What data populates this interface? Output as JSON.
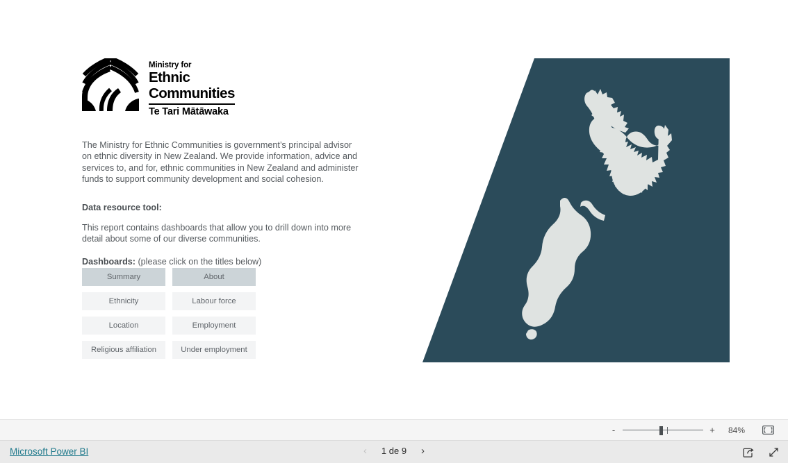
{
  "logo": {
    "mark_icon": "woven-fern-mark-icon",
    "line1": "Ministry for",
    "line2": "Ethnic",
    "line3": "Communities",
    "line4": "Te Tari Mātāwaka"
  },
  "content": {
    "intro_paragraph": "The Ministry for Ethnic Communities is government’s principal advisor on ethnic diversity in New Zealand. We provide information, advice and services to, and for, ethnic communities in New Zealand and administer funds to support community development and social cohesion.",
    "section_heading": "Data resource tool:",
    "report_description": "This report contains dashboards that allow you to drill down into more detail about some of our diverse communities.",
    "dashboards_label": "Dashboards:",
    "dashboards_hint": "(please click on the titles below)"
  },
  "dashboards": {
    "rows": [
      [
        {
          "label": "Summary",
          "selected": true
        },
        {
          "label": "About",
          "selected": true
        }
      ],
      [
        {
          "label": "Ethnicity",
          "selected": false
        },
        {
          "label": "Labour force",
          "selected": false
        }
      ],
      [
        {
          "label": "Location",
          "selected": false
        },
        {
          "label": "Employment",
          "selected": false
        }
      ],
      [
        {
          "label": "Religious affiliation",
          "selected": false
        },
        {
          "label": "Under employment",
          "selected": false
        }
      ]
    ]
  },
  "map": {
    "name": "new-zealand-map",
    "background_color": "#2b4b5a",
    "land_color": "#dfe3e1"
  },
  "zoom_toolbar": {
    "minus_label": "-",
    "plus_label": "+",
    "percent": "84%",
    "fit_icon": "fit-to-page-icon"
  },
  "footer": {
    "brand": "Microsoft Power BI",
    "brand_color": "#217a8c",
    "prev_icon": "chevron-left-icon",
    "next_icon": "chevron-right-icon",
    "page_indicator": "1 de 9",
    "share_icon": "share-icon",
    "fullscreen_icon": "fullscreen-icon"
  }
}
